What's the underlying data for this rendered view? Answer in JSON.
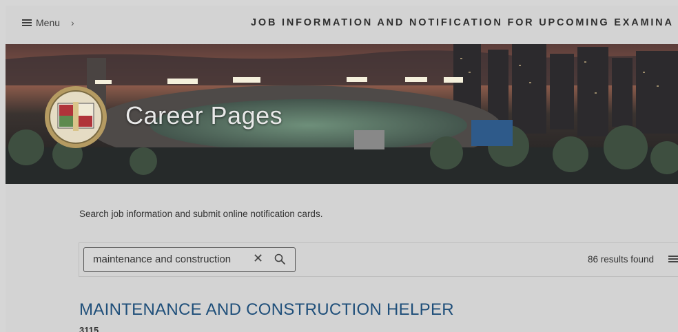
{
  "header": {
    "menu_label": "Menu",
    "chevron": "›",
    "title": "JOB INFORMATION AND NOTIFICATION FOR UPCOMING EXAMINA"
  },
  "banner": {
    "title": "Career Pages",
    "seal_top_text": "CITY OF LOS ANGELES",
    "seal_bottom_text": "FOUNDED 1781"
  },
  "intro": "Search job information and submit online notification cards.",
  "search": {
    "value": "maintenance and construction",
    "clear_glyph": "✕",
    "results_text": "86 results found"
  },
  "results": [
    {
      "title": "MAINTENANCE AND CONSTRUCTION HELPER",
      "code": "3115"
    }
  ],
  "icons": [
    "menu-icon",
    "chevron-right-icon",
    "close-icon",
    "search-icon",
    "list-view-icon",
    "city-seal-logo"
  ],
  "colors": {
    "page_bg": "#d3d3d3",
    "job_link": "#1f4f7a"
  }
}
